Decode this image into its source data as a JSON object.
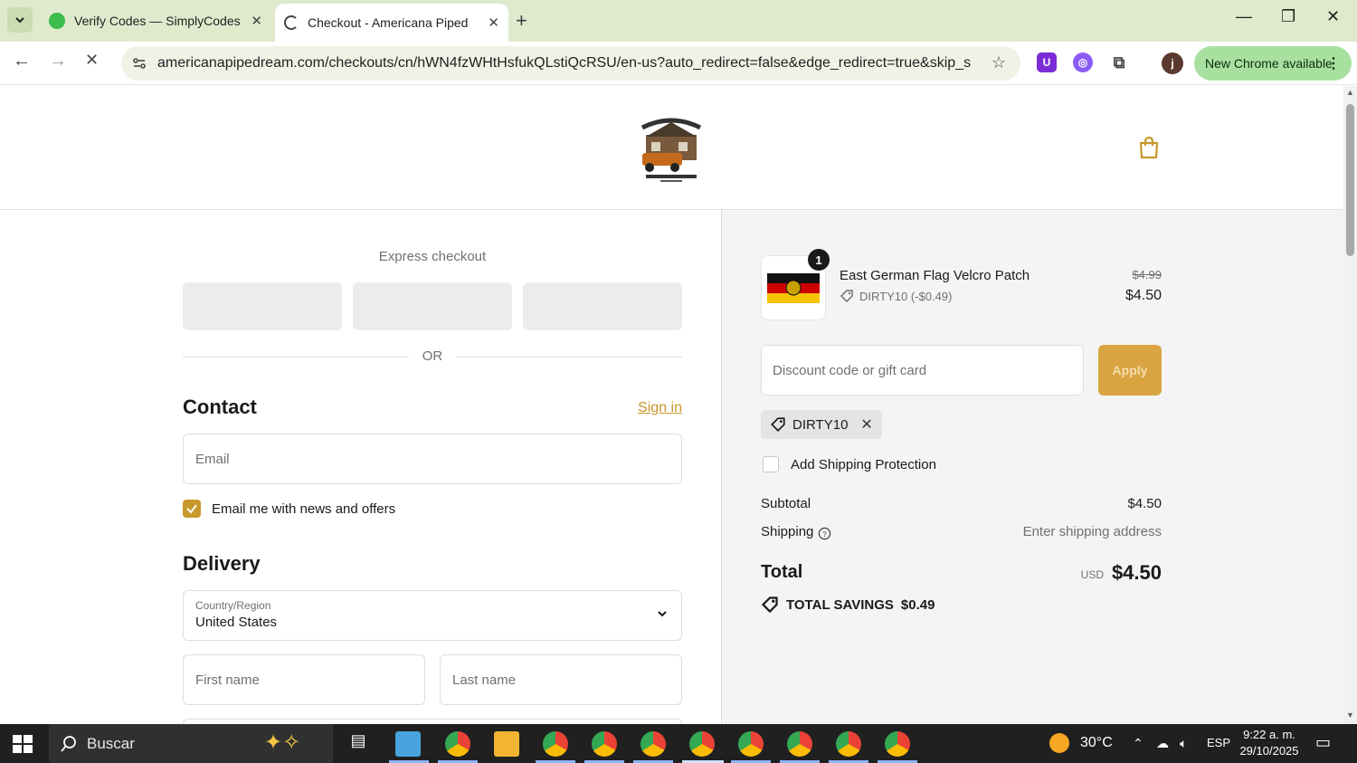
{
  "browser": {
    "tabs": [
      {
        "title": "Verify Codes — SimplyCodes",
        "active": false
      },
      {
        "title": "Checkout - Americana Pipedrea",
        "active": true
      }
    ],
    "url": "americanapipedream.com/checkouts/cn/hWN4fzWHtHsfukQLstiQcRSU/en-us?auto_redirect=false&edge_redirect=true&skip_shop_...",
    "update_label": "New Chrome available",
    "profile_initial": "j"
  },
  "checkout": {
    "express_label": "Express checkout",
    "or_label": "OR",
    "contact": {
      "heading": "Contact",
      "signin_label": "Sign in",
      "email_placeholder": "Email",
      "news_label": "Email me with news and offers",
      "news_checked": true
    },
    "delivery": {
      "heading": "Delivery",
      "country_label": "Country/Region",
      "country_value": "United States",
      "first_name_placeholder": "First name",
      "last_name_placeholder": "Last name"
    }
  },
  "summary": {
    "item": {
      "quantity": "1",
      "name": "East German Flag Velcro Patch",
      "discount": "DIRTY10 (-$0.49)",
      "original_price": "$4.99",
      "price": "$4.50"
    },
    "discount_placeholder": "Discount code or gift card",
    "apply_label": "Apply",
    "applied_code": "DIRTY10",
    "shipping_protection_label": "Add Shipping Protection",
    "subtotal_label": "Subtotal",
    "subtotal_value": "$4.50",
    "shipping_label": "Shipping",
    "shipping_value": "Enter shipping address",
    "total_label": "Total",
    "currency": "USD",
    "total_value": "$4.50",
    "savings_label": "TOTAL SAVINGS",
    "savings_value": "$0.49"
  },
  "taskbar": {
    "search_label": "Buscar",
    "temperature": "30°C",
    "language": "ESP",
    "time": "9:22 a. m.",
    "date": "29/10/2025"
  },
  "colors": {
    "accent": "#c7982a",
    "apply_button": "#d9a441",
    "summary_bg": "#f4f4f4"
  }
}
